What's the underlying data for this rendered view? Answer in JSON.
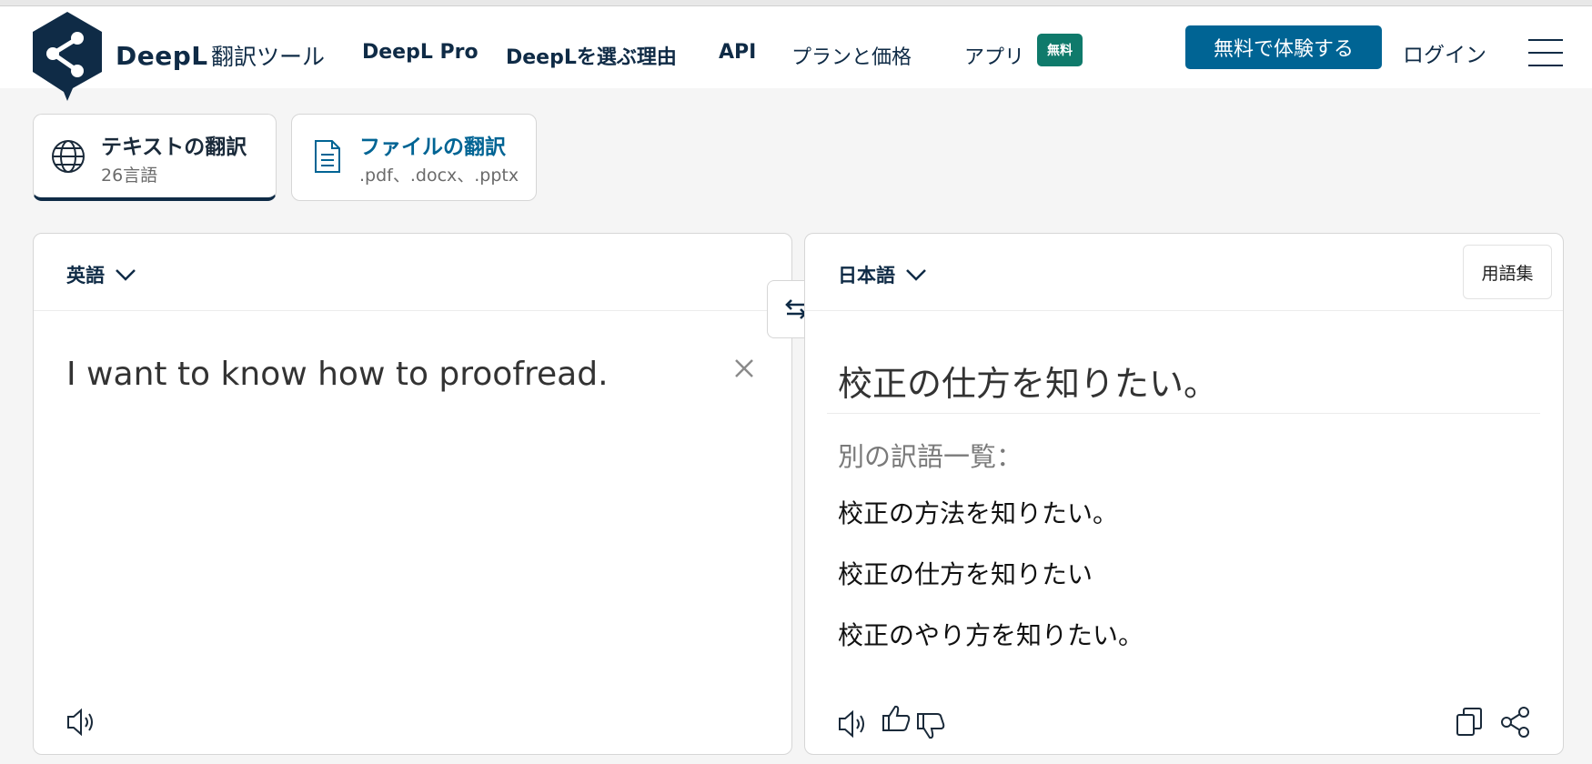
{
  "header": {
    "brand": "DeepL",
    "brand_sub": "翻訳ツール",
    "nav": [
      "DeepL Pro",
      "DeepLを選ぶ理由",
      "API",
      "プランと価格",
      "アプリ"
    ],
    "badge": "無料",
    "cta": "無料で体験する",
    "login": "ログイン"
  },
  "tabs": [
    {
      "title": "テキストの翻訳",
      "sub": "26言語",
      "icon": "globe-icon"
    },
    {
      "title": "ファイルの翻訳",
      "sub": ".pdf、.docx、.pptx",
      "icon": "document-icon"
    }
  ],
  "source": {
    "language": "英語",
    "text": "I want to know how to proofread."
  },
  "target": {
    "language": "日本語",
    "glossary": "用語集",
    "text": "校正の仕方を知りたい。",
    "alt_label": "別の訳語一覧：",
    "alternatives": [
      "校正の方法を知りたい。",
      "校正の仕方を知りたい",
      "校正のやり方を知りたい。"
    ]
  },
  "colors": {
    "brand_dark": "#0f2b46",
    "accent_blue": "#006494",
    "badge_green": "#0f7a6b"
  },
  "icons": [
    "deepl-logo-icon",
    "hamburger-menu-icon",
    "globe-icon",
    "document-icon",
    "chevron-down-icon",
    "swap-icon",
    "close-icon",
    "speaker-icon",
    "thumbs-up-icon",
    "thumbs-down-icon",
    "copy-icon",
    "share-icon"
  ]
}
